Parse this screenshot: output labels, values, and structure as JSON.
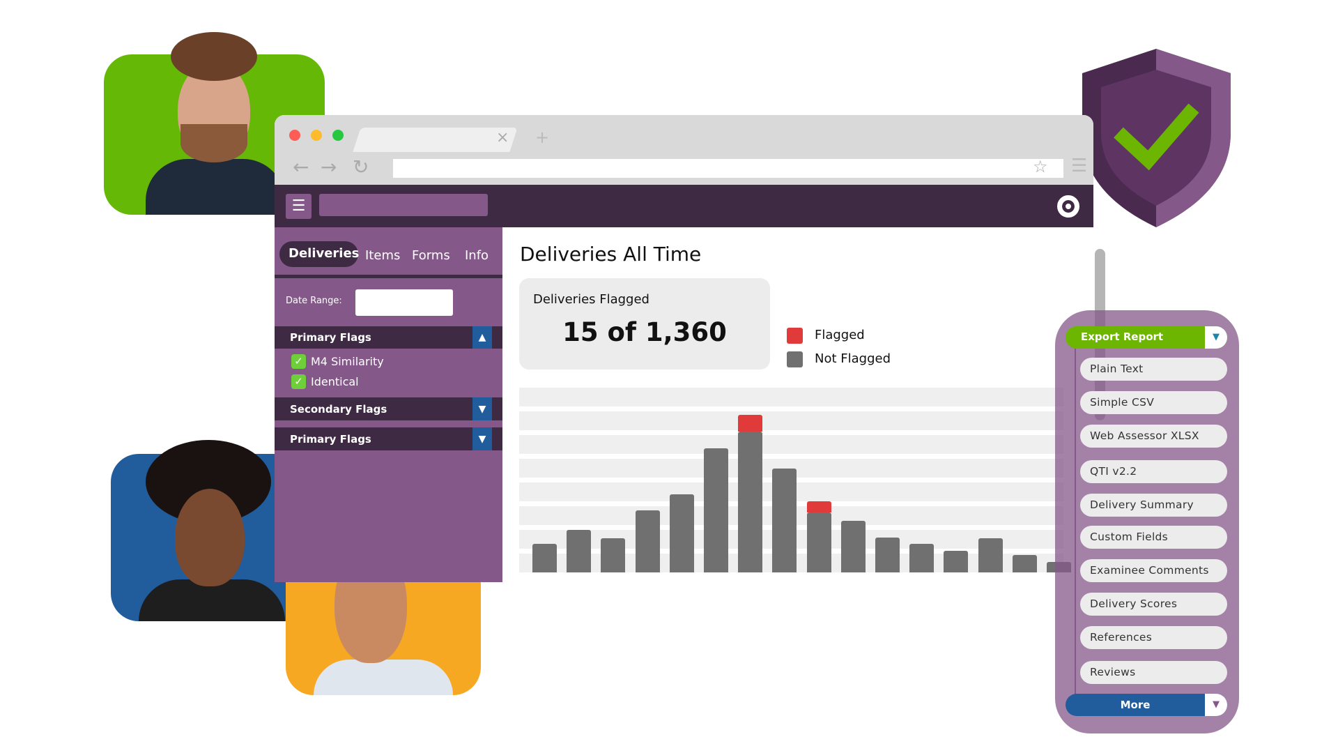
{
  "browser": {
    "new_tab_label": "+",
    "close_tab_label": "×"
  },
  "sidebar": {
    "tabs": [
      {
        "label": "Deliveries",
        "active": true
      },
      {
        "label": "Items"
      },
      {
        "label": "Forms"
      },
      {
        "label": "Info"
      }
    ],
    "date_range_label": "Date Range:",
    "date_range_value": "",
    "sections": [
      {
        "label": "Primary Flags",
        "expanded": true,
        "items": [
          {
            "label": "M4 Similarity",
            "checked": true
          },
          {
            "label": "Identical",
            "checked": true
          }
        ]
      },
      {
        "label": "Secondary Flags",
        "expanded": false
      },
      {
        "label": "Primary Flags",
        "expanded": false
      }
    ]
  },
  "main": {
    "title": "Deliveries All Time",
    "card": {
      "label": "Deliveries Flagged",
      "value": "15 of 1,360"
    },
    "legend": [
      {
        "label": "Flagged",
        "color": "#e03a3a"
      },
      {
        "label": "Not Flagged",
        "color": "#707070"
      }
    ]
  },
  "chart_data": {
    "type": "bar",
    "stacked": true,
    "grid": true,
    "legend": "right of card",
    "series": [
      {
        "name": "Not Flagged",
        "color": "#707070",
        "values": [
          33,
          50,
          40,
          72,
          91,
          145,
          164,
          121,
          70,
          60,
          41,
          33,
          25,
          40,
          20,
          12
        ]
      },
      {
        "name": "Flagged",
        "color": "#e03a3a",
        "values": [
          0,
          0,
          0,
          0,
          0,
          0,
          20,
          0,
          13,
          0,
          0,
          0,
          0,
          0,
          0,
          0
        ]
      }
    ]
  },
  "export": {
    "title": "Export Report",
    "options": [
      "Plain Text",
      "Simple CSV",
      "Web Assessor XLSX",
      "QTI v2.2",
      "Delivery Summary",
      "Custom Fields",
      "Examinee Comments",
      "Delivery Scores",
      "References",
      "Reviews"
    ],
    "more": "More"
  },
  "colors": {
    "brand_dark": "#3f2a44",
    "brand_purple": "#85588a",
    "accent_green": "#6cb500",
    "accent_blue": "#215c9c",
    "flag_red": "#e03a3a"
  }
}
